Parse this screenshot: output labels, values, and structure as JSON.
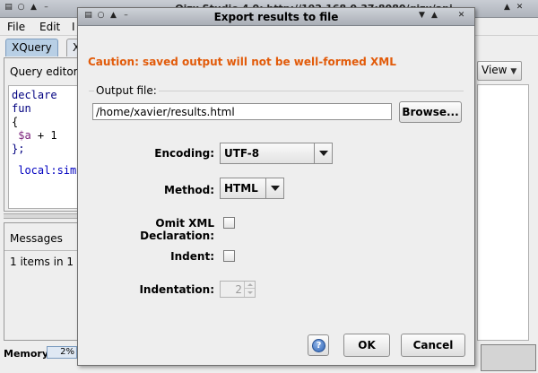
{
  "main_window": {
    "title": "Qizx Studio 4.0: http://192.168.0.37:8080/qizx/api",
    "menu": [
      "File",
      "Edit",
      "I"
    ],
    "tabs": [
      "XQuery",
      "X"
    ],
    "query_panel": {
      "header": "Query editor",
      "code": {
        "line1_kw": "declare",
        "line1_rest": " fun",
        "line2": "{",
        "line3_var": "$a",
        "line3_rest": " + 1",
        "line4": "};",
        "line5": "local:sim"
      }
    },
    "messages_panel": {
      "header": "Messages",
      "body": "1 items in 1"
    },
    "status": {
      "memory_label": "Memory:",
      "memory_value": "2%"
    },
    "view_button": "View"
  },
  "dialog": {
    "title": "Export results to file",
    "caution": "Caution: saved output will not be well-formed XML",
    "output_file_group": "Output file:",
    "output_path": "/home/xavier/results.html",
    "browse_button": "Browse...",
    "encoding_label": "Encoding:",
    "encoding_value": "UTF-8",
    "method_label": "Method:",
    "method_value": "HTML",
    "omit_xml_label": "Omit XML Declaration:",
    "indent_label": "Indent:",
    "indentation_label": "Indentation:",
    "indentation_value": "2",
    "ok_button": "OK",
    "cancel_button": "Cancel",
    "help_glyph": "?"
  },
  "colors": {
    "caution": "#e25b0a",
    "tab_active": "#b8cfe5",
    "help_icon": "#2f64b5"
  },
  "icons": [
    "window-menu-icon",
    "sticky-icon",
    "shade-icon",
    "minimize-icon",
    "maximize-icon",
    "close-icon",
    "chevron-down-icon",
    "help-icon"
  ]
}
